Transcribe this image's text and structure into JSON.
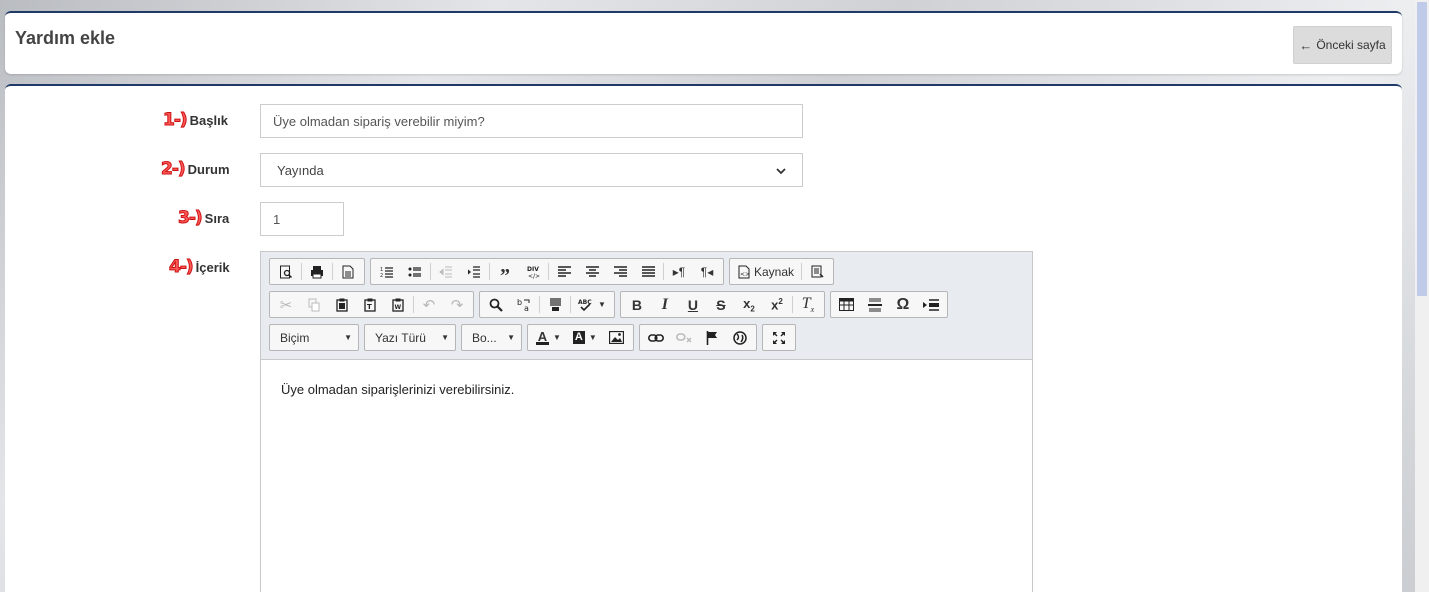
{
  "header": {
    "title": "Yardım ekle",
    "back_button": "Önceki sayfa"
  },
  "form": {
    "title_field": {
      "step": "1-)",
      "label": "Başlık",
      "value": "Üye olmadan sipariş verebilir miyim?"
    },
    "status_field": {
      "step": "2-)",
      "label": "Durum",
      "value": "Yayında"
    },
    "order_field": {
      "step": "3-)",
      "label": "Sıra",
      "value": "1"
    },
    "content_field": {
      "step": "4-)",
      "label": "İçerik"
    }
  },
  "editor": {
    "source_label": "Kaynak",
    "format_combo": "Biçim",
    "font_combo": "Yazı Türü",
    "size_combo": "Bo...",
    "content": "Üye olmadan siparişlerinizi verebilirsiniz."
  }
}
